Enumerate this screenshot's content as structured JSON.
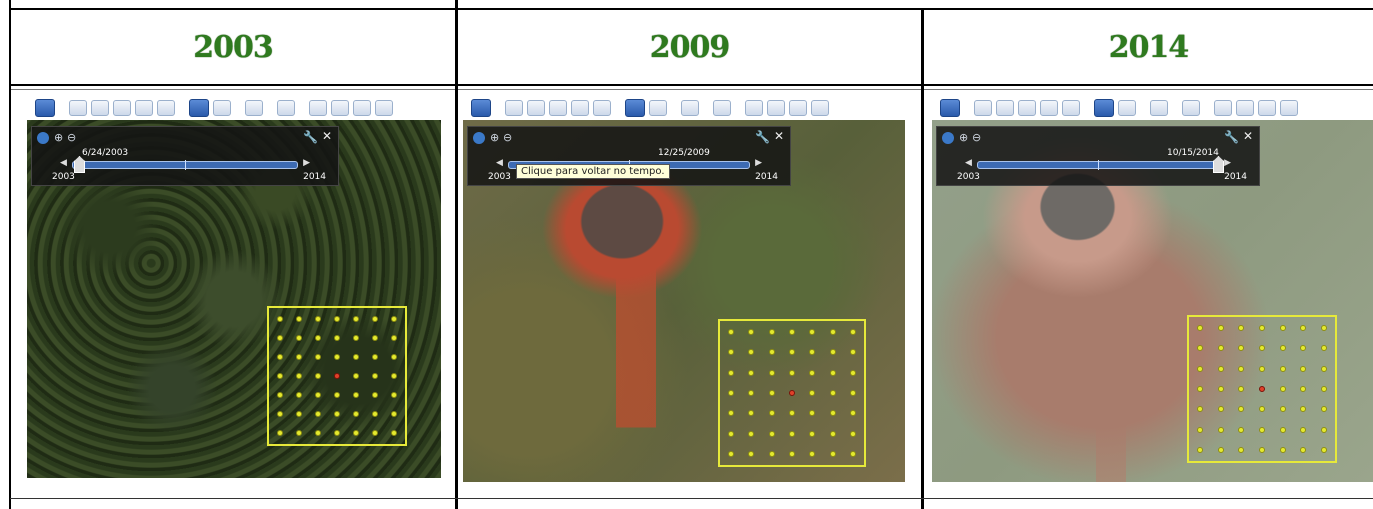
{
  "columns": [
    {
      "year": "2003",
      "slider": {
        "date": "6/24/2003",
        "start_year": "2003",
        "end_year": "2014",
        "position": 0.0
      },
      "tooltip": ""
    },
    {
      "year": "2009",
      "slider": {
        "date": "12/25/2009",
        "start_year": "2003",
        "end_year": "2014",
        "position": 0.65
      },
      "tooltip": "Clique para voltar no tempo."
    },
    {
      "year": "2014",
      "slider": {
        "date": "10/15/2014",
        "start_year": "2003",
        "end_year": "2014",
        "position": 0.98
      },
      "tooltip": ""
    }
  ],
  "colors": {
    "year_heading": "#2f7a1f",
    "sample_grid": "#e6e93a",
    "sample_point": "#e4ea2f",
    "center_point": "#e0412a",
    "time_slider": "#3d6bb3"
  },
  "toolbar_icons": [
    "sidebar-icon",
    "placemark-icon",
    "polygon-icon",
    "path-icon",
    "overlay-icon",
    "record-tour-icon",
    "historical-imagery-icon",
    "sunlight-icon",
    "planets-icon",
    "ruler-icon",
    "email-icon",
    "print-icon",
    "save-image-icon",
    "maps-icon"
  ]
}
